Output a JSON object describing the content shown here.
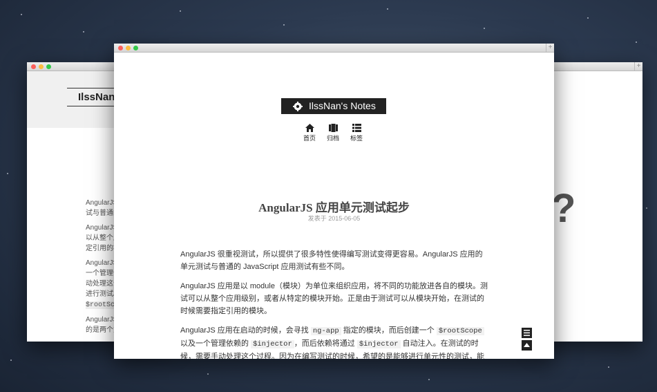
{
  "left_window": {
    "logo_text": "IlssNan's",
    "lines": [
      [
        "AngularJS",
        "试与普通的"
      ],
      [
        "AngularJS",
        "以从整个应",
        "定引用的模"
      ],
      [
        "AngularJS",
        "一个管理依",
        "动处理这个",
        "进行测试。",
        "$rootSco"
      ],
      [
        "AngularJS",
        "的是两个方"
      ]
    ]
  },
  "right_window": {
    "question_mark": "?"
  },
  "main_window": {
    "brand": "IlssNan's Notes",
    "nav": [
      {
        "label": "首页",
        "icon": "home-icon"
      },
      {
        "label": "归档",
        "icon": "archive-icon"
      },
      {
        "label": "标签",
        "icon": "tags-icon"
      }
    ],
    "post": {
      "title": "AngularJS 应用单元测试起步",
      "date": "发表于 2015-06-05"
    },
    "paragraphs": {
      "p1": "AngularJS 很重视测试，所以提供了很多特性使得编写测试变得更容易。AngularJS 应用的单元测试与普通的 JavaScript 应用测试有些不同。",
      "p2": "AngularJS 应用是以 module（模块）为单位来组织应用，将不同的功能放进各自的模块。测试可以从整个应用级别，或者从特定的模块开始。正是由于测试可以从模块开始，在测试的时候需要指定引用的模块。",
      "p3_a": "AngularJS 应用在启动的时候，会寻找",
      "p3_code1": "ng-app",
      "p3_b": "指定的模块，而后创建一个",
      "p3_code2": "$rootScope",
      "p3_c": "以及一个管理依赖的",
      "p3_code3": "$injector",
      "p3_d": "，而后依赖将通过",
      "p3_code4": "$injector",
      "p3_e": "自动注入。在测试的时候，需要手动处理这个过程。因为在编写测试的时候，希望的是能够进行单元性的测试，能够针对特定的模块"
    }
  }
}
